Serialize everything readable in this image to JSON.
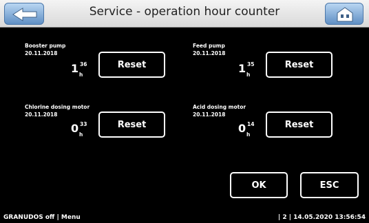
{
  "window": {
    "title": "Service - operation hour counter"
  },
  "colors": {
    "background": "#000000",
    "titlebar": "#e6e6e6",
    "nav_button": "#7fa8d6"
  },
  "counters": [
    {
      "name": "Booster pump",
      "date": "20.11.2018",
      "hours": "1",
      "minutes": "36",
      "unit": "h",
      "reset_label": "Reset"
    },
    {
      "name": "Feed pump",
      "date": "20.11.2018",
      "hours": "1",
      "minutes": "35",
      "unit": "h",
      "reset_label": "Reset"
    },
    {
      "name": "Chlorine dosing motor",
      "date": "20.11.2018",
      "hours": "0",
      "minutes": "33",
      "unit": "h",
      "reset_label": "Reset"
    },
    {
      "name": "Acid dosing motor",
      "date": "20.11.2018",
      "hours": "0",
      "minutes": "14",
      "unit": "h",
      "reset_label": "Reset"
    }
  ],
  "dialog": {
    "ok_label": "OK",
    "esc_label": "ESC"
  },
  "status": {
    "left": "GRANUDOS off | Menu",
    "right": "| 2 | 14.05.2020 13:56:54"
  }
}
